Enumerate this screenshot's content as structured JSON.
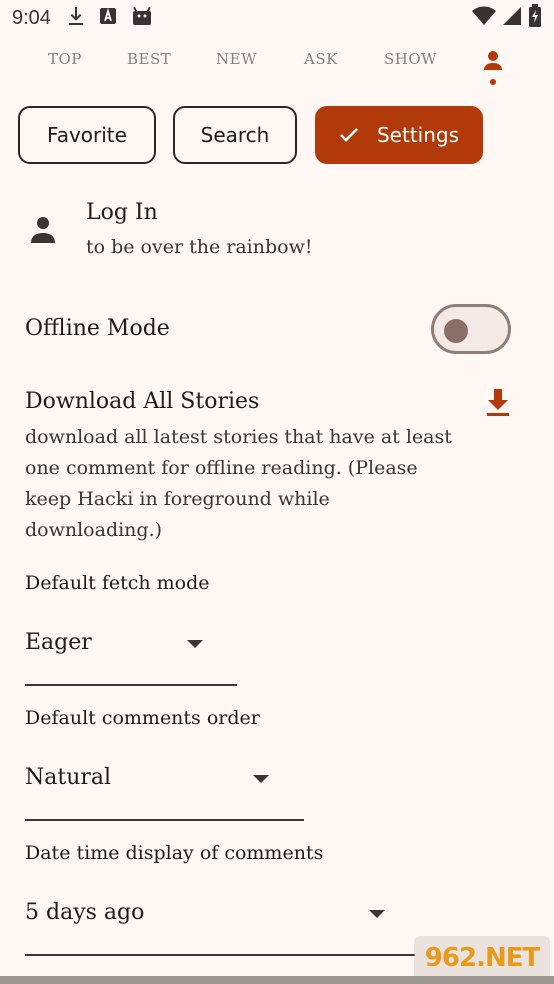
{
  "status_bar": {
    "time": "9:04",
    "icons": [
      "download-icon",
      "font-icon",
      "android-icon"
    ],
    "right_icons": [
      "wifi-icon",
      "signal-icon",
      "battery-icon"
    ]
  },
  "tabs": [
    {
      "label": "TOP"
    },
    {
      "label": "BEST"
    },
    {
      "label": "NEW"
    },
    {
      "label": "ASK"
    },
    {
      "label": "SHOW"
    }
  ],
  "chips": {
    "favorite": "Favorite",
    "search": "Search",
    "settings": "Settings"
  },
  "login": {
    "title": "Log In",
    "subtitle": "to be over the rainbow!"
  },
  "offline_mode": {
    "label": "Offline Mode",
    "enabled": false
  },
  "download_all": {
    "title": "Download All Stories",
    "description": "download all latest stories that have at least one comment for offline reading. (Please keep Hacki in foreground while downloading.)"
  },
  "fetch_mode": {
    "label": "Default fetch mode",
    "value": "Eager"
  },
  "comments_order": {
    "label": "Default comments order",
    "value": "Natural"
  },
  "date_display": {
    "label": "Date time display of comments",
    "value": "5 days ago"
  },
  "colors": {
    "accent": "#b23a0a",
    "background": "#fff7f4",
    "text": "#231a17"
  },
  "watermark": "962.NET"
}
